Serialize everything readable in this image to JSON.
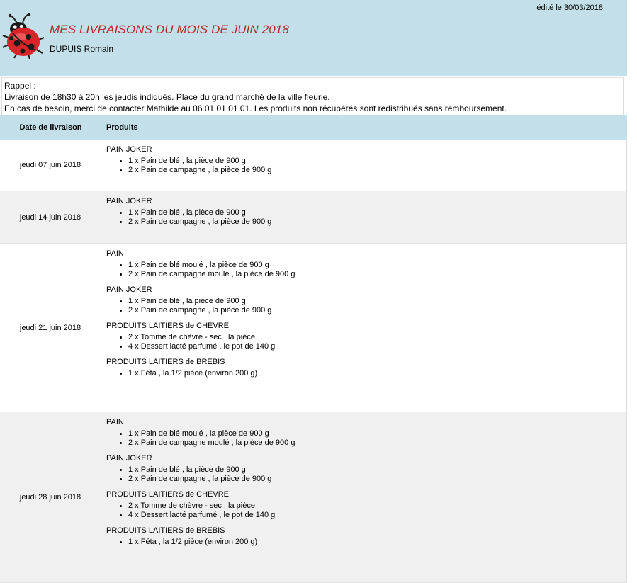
{
  "header": {
    "edited": "édité le 30/03/2018",
    "title": "MES LIVRAISONS DU MOIS DE JUIN 2018",
    "name": "DUPUIS Romain",
    "logo_icon": "ladybug-icon"
  },
  "reminder": {
    "line1": "Rappel :",
    "line2": "Livraison de 18h30 à 20h les jeudis indiqués. Place du grand marché de la ville fleurie.",
    "line3": "En cas de besoin, merci de contacter Mathilde au 06 01 01 01 01. Les produits non récupérés sont redistribués sans remboursement."
  },
  "table": {
    "col_date": "Date de livraison",
    "col_products": "Produits",
    "rows": [
      {
        "date": "jeudi 07 juin 2018",
        "groups": [
          {
            "title": "PAIN JOKER",
            "items": [
              "1 x Pain de blé , la pièce de 900 g",
              "2 x Pain de campagne , la pièce de 900 g"
            ]
          }
        ]
      },
      {
        "date": "jeudi 14 juin 2018",
        "groups": [
          {
            "title": "PAIN JOKER",
            "items": [
              "1 x Pain de blé , la pièce de 900 g",
              "2 x Pain de campagne , la pièce de 900 g"
            ]
          }
        ]
      },
      {
        "date": "jeudi 21 juin 2018",
        "groups": [
          {
            "title": "PAIN",
            "items": [
              "1 x Pain de blé moulé , la pièce de 900 g",
              "2 x Pain de campagne moulé , la pièce de 900 g"
            ]
          },
          {
            "title": "PAIN JOKER",
            "items": [
              "1 x Pain de blé , la pièce de 900 g",
              "2 x Pain de campagne , la pièce de 900 g"
            ]
          },
          {
            "title": "PRODUITS LAITIERS de CHEVRE",
            "items": [
              "2 x Tomme de chèvre - sec , la pièce",
              "4 x Dessert lacté parfumé , le pot de 140 g"
            ]
          },
          {
            "title": "PRODUITS LAITIERS de BREBIS",
            "items": [
              "1 x Féta , la 1/2 pièce (environ 200 g)"
            ]
          }
        ]
      },
      {
        "date": "jeudi 28 juin 2018",
        "groups": [
          {
            "title": "PAIN",
            "items": [
              "1 x Pain de blé moulé , la pièce de 900 g",
              "2 x Pain de campagne moulé , la pièce de 900 g"
            ]
          },
          {
            "title": "PAIN JOKER",
            "items": [
              "1 x Pain de blé , la pièce de 900 g",
              "2 x Pain de campagne , la pièce de 900 g"
            ]
          },
          {
            "title": "PRODUITS LAITIERS de CHEVRE",
            "items": [
              "2 x Tomme de chèvre - sec , la pièce",
              "4 x Dessert lacté parfumé , le pot de 140 g"
            ]
          },
          {
            "title": "PRODUITS LAITIERS de BREBIS",
            "items": [
              "1 x Féta , la 1/2 pièce (environ 200 g)"
            ]
          }
        ]
      }
    ]
  }
}
